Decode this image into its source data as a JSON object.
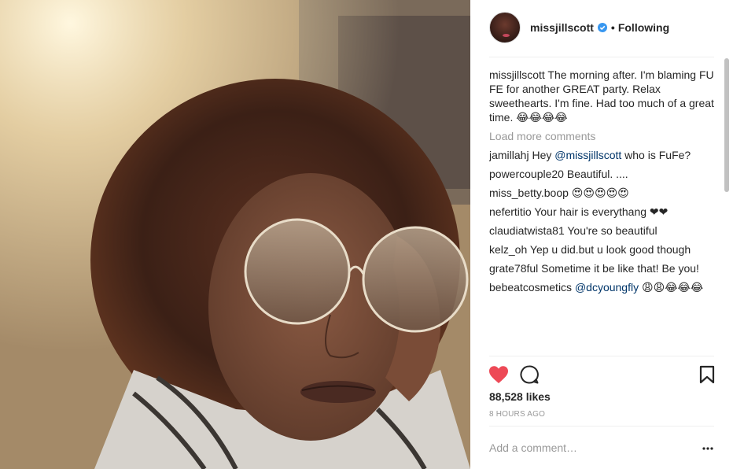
{
  "post": {
    "username": "missjillscott",
    "verified": true,
    "follow_status": "Following",
    "separator": "•"
  },
  "caption": {
    "username": "missjillscott",
    "text": "The morning after. I'm blaming FU FE for another GREAT party. Relax sweethearts. I'm fine. Had too much of a great time. 😂😂😂😂"
  },
  "load_more_label": "Load more comments",
  "comments": [
    {
      "user": "jamillahj",
      "pre": "Hey ",
      "mention": "@missjillscott",
      "post": " who is FuFe?"
    },
    {
      "user": "powercouple20",
      "pre": "Beautiful. ....",
      "mention": "",
      "post": ""
    },
    {
      "user": "miss_betty.boop",
      "pre": "😍😍😍😍😍",
      "mention": "",
      "post": ""
    },
    {
      "user": "nefertitio",
      "pre": "Your hair is everythang ❤❤",
      "mention": "",
      "post": ""
    },
    {
      "user": "claudiatwista81",
      "pre": "You're so beautiful",
      "mention": "",
      "post": ""
    },
    {
      "user": "kelz_oh",
      "pre": "Yep u did.but u look good though",
      "mention": "",
      "post": ""
    },
    {
      "user": "grate78ful",
      "pre": "Sometime it be like that! Be you!",
      "mention": "",
      "post": ""
    },
    {
      "user": "bebeatcosmetics",
      "pre": "",
      "mention": "@dcyoungfly",
      "post": " 😩😩😂😂😂"
    }
  ],
  "likes": "88,528 likes",
  "timestamp": "8 HOURS AGO",
  "add_comment_placeholder": "Add a comment…",
  "colors": {
    "heart": "#ed4956",
    "verified": "#3897f0",
    "mention": "#003569",
    "muted": "#999999"
  },
  "icons": {
    "like": "heart-icon",
    "comment": "comment-icon",
    "save": "bookmark-icon",
    "more": "more-options-icon",
    "verified": "verified-badge-icon"
  }
}
